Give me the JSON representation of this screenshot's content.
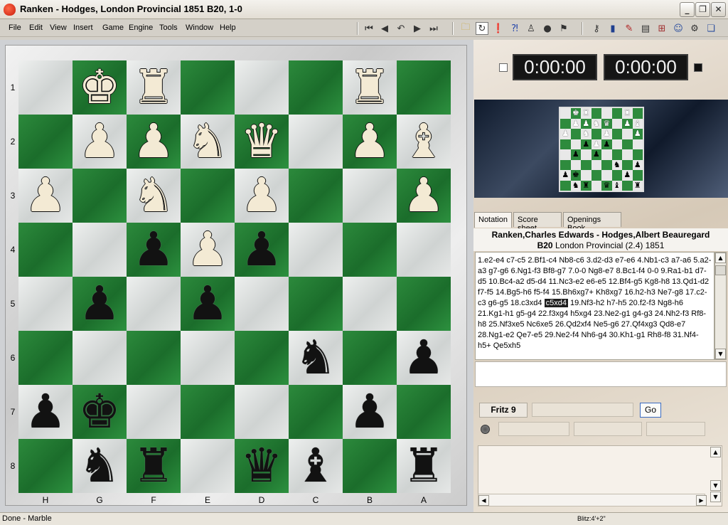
{
  "window": {
    "title": "Ranken - Hodges, London Provincial 1851  B20, 1-0"
  },
  "menu": [
    "File",
    "Edit",
    "View",
    "Insert",
    "Game",
    "Engine",
    "Tools",
    "Window",
    "Help"
  ],
  "toolbar": {
    "nav_icons": [
      "first-move-icon",
      "prev-move-icon",
      "back-variation-icon",
      "next-move-icon",
      "last-move-icon"
    ],
    "tool_icons": [
      "new-game-icon",
      "flip-board-icon",
      "hint-icon",
      "analysis-icon",
      "player-icon",
      "globe-icon",
      "flag-icon",
      "key-icon",
      "book-icon",
      "pen-icon",
      "print-icon",
      "board-setup-icon",
      "user-icon",
      "settings-icon"
    ]
  },
  "board": {
    "files": [
      "H",
      "G",
      "F",
      "E",
      "D",
      "C",
      "B",
      "A"
    ],
    "ranks": [
      "1",
      "2",
      "3",
      "4",
      "5",
      "6",
      "7",
      "8"
    ],
    "pieces": [
      {
        "sq": "g1",
        "glyph": "♚",
        "color": "white"
      },
      {
        "sq": "f1",
        "glyph": "♜",
        "color": "white"
      },
      {
        "sq": "b1",
        "glyph": "♜",
        "color": "white"
      },
      {
        "sq": "g2",
        "glyph": "♟",
        "color": "white"
      },
      {
        "sq": "f2",
        "glyph": "♟",
        "color": "white"
      },
      {
        "sq": "e2",
        "glyph": "♞",
        "color": "white"
      },
      {
        "sq": "d2",
        "glyph": "♛",
        "color": "white"
      },
      {
        "sq": "b2",
        "glyph": "♟",
        "color": "white"
      },
      {
        "sq": "a2",
        "glyph": "♝",
        "color": "white"
      },
      {
        "sq": "h3",
        "glyph": "♟",
        "color": "white"
      },
      {
        "sq": "f3",
        "glyph": "♞",
        "color": "white"
      },
      {
        "sq": "d3",
        "glyph": "♟",
        "color": "white"
      },
      {
        "sq": "a3",
        "glyph": "♟",
        "color": "white"
      },
      {
        "sq": "f4",
        "glyph": "♟",
        "color": "black"
      },
      {
        "sq": "e4",
        "glyph": "♟",
        "color": "white"
      },
      {
        "sq": "d4",
        "glyph": "♟",
        "color": "black"
      },
      {
        "sq": "g5",
        "glyph": "♟",
        "color": "black"
      },
      {
        "sq": "e5",
        "glyph": "♟",
        "color": "black"
      },
      {
        "sq": "c6",
        "glyph": "♞",
        "color": "black"
      },
      {
        "sq": "a6",
        "glyph": "♟",
        "color": "black"
      },
      {
        "sq": "h7",
        "glyph": "♟",
        "color": "black"
      },
      {
        "sq": "g7",
        "glyph": "♚",
        "color": "black"
      },
      {
        "sq": "b7",
        "glyph": "♟",
        "color": "black"
      },
      {
        "sq": "g8",
        "glyph": "♞",
        "color": "black"
      },
      {
        "sq": "f8",
        "glyph": "♜",
        "color": "black"
      },
      {
        "sq": "d8",
        "glyph": "♛",
        "color": "black"
      },
      {
        "sq": "c8",
        "glyph": "♝",
        "color": "black"
      },
      {
        "sq": "a8",
        "glyph": "♜",
        "color": "black"
      }
    ]
  },
  "clocks": {
    "left": "0:00:00",
    "right": "0:00:00"
  },
  "tabs": [
    "Notation",
    "Score sheet",
    "Openings Book"
  ],
  "game": {
    "players": "Ranken,Charles Edwards - Hodges,Albert Beauregard",
    "eco": "B20",
    "info": "London Provincial (2.4) 1851"
  },
  "notation": {
    "before": "1.e2-e4  c7-c5  2.Bf1-c4  Nb8-c6  3.d2-d3  e7-e6  4.Nb1-c3  a7-a6  5.a2-a3  g7-g6  6.Ng1-f3  Bf8-g7  7.0-0  Ng8-e7  8.Bc1-f4  0-0  9.Ra1-b1  d7-d5  10.Bc4-a2  d5-d4  11.Nc3-e2  e6-e5  12.Bf4-g5  Kg8-h8  13.Qd1-d2  f7-f5  14.Bg5-h6  f5-f4  15.Bh6xg7+  Kh8xg7  16.h2-h3  Ne7-g8  17.c2-c3  g6-g5  18.c3xd4 ",
    "highlight": "c5xd4",
    "after": " 19.Nf3-h2  h7-h5  20.f2-f3  Ng8-h6  21.Kg1-h1  g5-g4  22.f3xg4  h5xg4  23.Ne2-g1  g4-g3  24.Nh2-f3  Rf8-h8  25.Nf3xe5  Nc6xe5  26.Qd2xf4  Ne5-g6  27.Qf4xg3  Qd8-e7  28.Ng1-e2  Qe7-e5  29.Ne2-f4  Nh6-g4  30.Kh1-g1  Rh8-f8  31.Nf4-h5+  Qe5xh5"
  },
  "engine": {
    "name": "Fritz 9",
    "go_label": "Go"
  },
  "status": {
    "left": "Done - Marble",
    "right": "Blitz:4'+2\""
  }
}
